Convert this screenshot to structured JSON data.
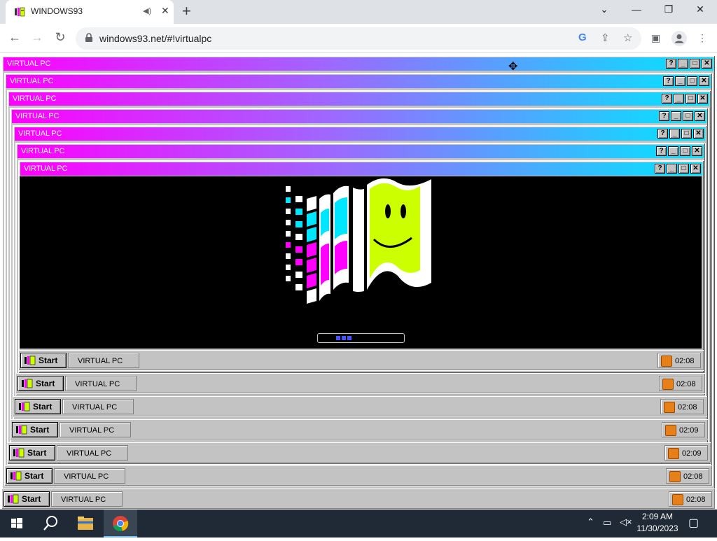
{
  "browser": {
    "tab_title": "WINDOWS93",
    "url": "windows93.net/#!virtualpc",
    "icons": [
      "windows93-favicon",
      "audio-icon",
      "close-icon",
      "new-tab-icon",
      "back-icon",
      "forward-icon",
      "reload-icon",
      "lock-icon",
      "google-icon",
      "share-icon",
      "star-icon",
      "side-panel-icon",
      "profile-icon",
      "menu-icon",
      "chevron-down-icon",
      "minimize-icon",
      "restore-icon"
    ]
  },
  "virtual_pc": {
    "window_title": "VIRTUAL PC",
    "window_count": 7,
    "title_buttons": [
      "?",
      "_",
      "□",
      "✕"
    ],
    "accent_colors": {
      "magenta": "#ff00ff",
      "cyan": "#00e6ff",
      "lime": "#ccff00"
    }
  },
  "taskbars": [
    {
      "start_label": "Start",
      "task_label": "VIRTUAL PC",
      "time": "02:08"
    },
    {
      "start_label": "Start",
      "task_label": "VIRTUAL PC",
      "time": "02:08"
    },
    {
      "start_label": "Start",
      "task_label": "VIRTUAL PC",
      "time": "02:08"
    },
    {
      "start_label": "Start",
      "task_label": "VIRTUAL PC",
      "time": "02:09"
    },
    {
      "start_label": "Start",
      "task_label": "VIRTUAL PC",
      "time": "02:09"
    },
    {
      "start_label": "Start",
      "task_label": "VIRTUAL PC",
      "time": "02:08"
    },
    {
      "start_label": "Start",
      "task_label": "VIRTUAL PC",
      "time": "02:08"
    }
  ],
  "windows_taskbar": {
    "clock_time": "2:09 AM",
    "clock_date": "11/30/2023",
    "icons": [
      "windows-start-icon",
      "search-icon",
      "file-explorer-icon",
      "chrome-icon",
      "chevron-up-icon",
      "network-icon",
      "volume-muted-icon",
      "notifications-icon"
    ]
  }
}
